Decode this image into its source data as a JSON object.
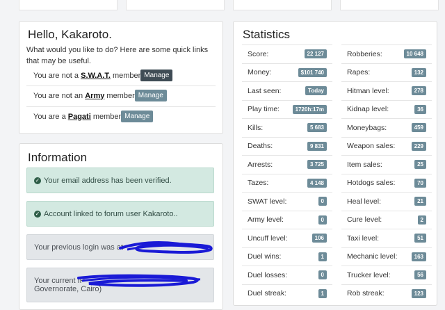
{
  "greeting": {
    "title": "Hello, Kakaroto.",
    "intro": "What would you like to do? Here are some quick links that may be useful.",
    "links": [
      {
        "prefix": "You are not a ",
        "group": "S.W.A.T.",
        "suffix": " member",
        "button": "Manage"
      },
      {
        "prefix": "You are not an ",
        "group": "Army",
        "suffix": " member",
        "button": "Manage"
      },
      {
        "prefix": "You are a ",
        "group": "Pagati",
        "suffix": " member",
        "button": "Manage"
      }
    ]
  },
  "information": {
    "title": "Information",
    "messages": [
      "Your email address has been verified.",
      "Account linked to forum user Kakaroto..",
      "Your previous login was at",
      "Your current IP",
      "Governorate, Cairo)"
    ]
  },
  "statistics": {
    "title": "Statistics",
    "left": [
      {
        "label": "Score:",
        "value": "22 127"
      },
      {
        "label": "Money:",
        "value": "$101 740"
      },
      {
        "label": "Last seen:",
        "value": "Today"
      },
      {
        "label": "Play time:",
        "value": "1720h:17m"
      },
      {
        "label": "Kills:",
        "value": "5 683"
      },
      {
        "label": "Deaths:",
        "value": "9 831"
      },
      {
        "label": "Arrests:",
        "value": "3 725"
      },
      {
        "label": "Tazes:",
        "value": "4 148"
      },
      {
        "label": "SWAT level:",
        "value": "0"
      },
      {
        "label": "Army level:",
        "value": "0"
      },
      {
        "label": "Uncuff level:",
        "value": "106"
      },
      {
        "label": "Duel wins:",
        "value": "1"
      },
      {
        "label": "Duel losses:",
        "value": "0"
      },
      {
        "label": "Duel streak:",
        "value": "1"
      }
    ],
    "right": [
      {
        "label": "Robberies:",
        "value": "10 648"
      },
      {
        "label": "Rapes:",
        "value": "132"
      },
      {
        "label": "Hitman level:",
        "value": "278"
      },
      {
        "label": "Kidnap level:",
        "value": "36"
      },
      {
        "label": "Moneybags:",
        "value": "459"
      },
      {
        "label": "Weapon sales:",
        "value": "229"
      },
      {
        "label": "Item sales:",
        "value": "25"
      },
      {
        "label": "Hotdogs sales:",
        "value": "70"
      },
      {
        "label": "Heal level:",
        "value": "21"
      },
      {
        "label": "Cure level:",
        "value": "2"
      },
      {
        "label": "Taxi level:",
        "value": "51"
      },
      {
        "label": "Mechanic level:",
        "value": "163"
      },
      {
        "label": "Trucker level:",
        "value": "56"
      },
      {
        "label": "Rob streak:",
        "value": "123"
      }
    ]
  }
}
